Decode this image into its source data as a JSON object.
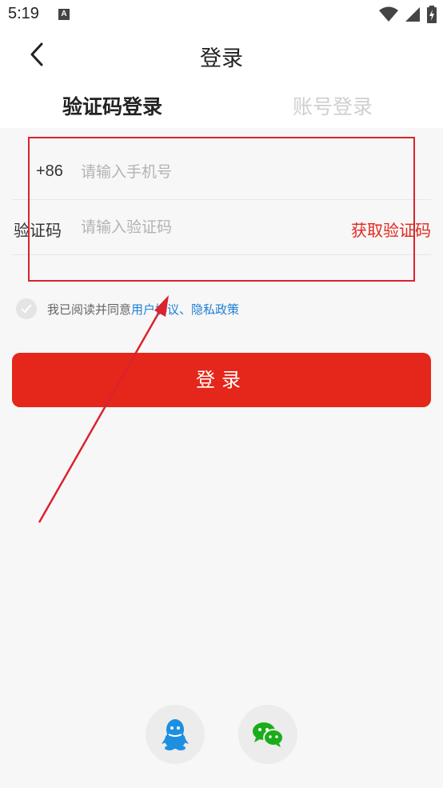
{
  "status_bar": {
    "time": "5:19",
    "notification_icon": "A"
  },
  "header": {
    "title": "登录",
    "tabs": [
      {
        "label": "验证码登录",
        "active": true
      },
      {
        "label": "账号登录",
        "active": false
      }
    ]
  },
  "form": {
    "phone": {
      "prefix": "+86",
      "placeholder": "请输入手机号",
      "value": ""
    },
    "code": {
      "label": "验证码",
      "placeholder": "请输入验证码",
      "value": "",
      "get_code_label": "获取验证码"
    }
  },
  "agreement": {
    "text": "我已阅读并同意",
    "user_agreement": "用户协议",
    "separator": "、",
    "privacy_policy": "隐私政策",
    "checked": false
  },
  "login_button": {
    "label": "登录"
  },
  "social": [
    {
      "name": "qq-icon",
      "color": "#1e8fe0"
    },
    {
      "name": "wechat-icon",
      "color": "#1aad19"
    }
  ],
  "colors": {
    "accent": "#e4271a",
    "link": "#1e7fd6",
    "annotation": "#d9232e"
  }
}
